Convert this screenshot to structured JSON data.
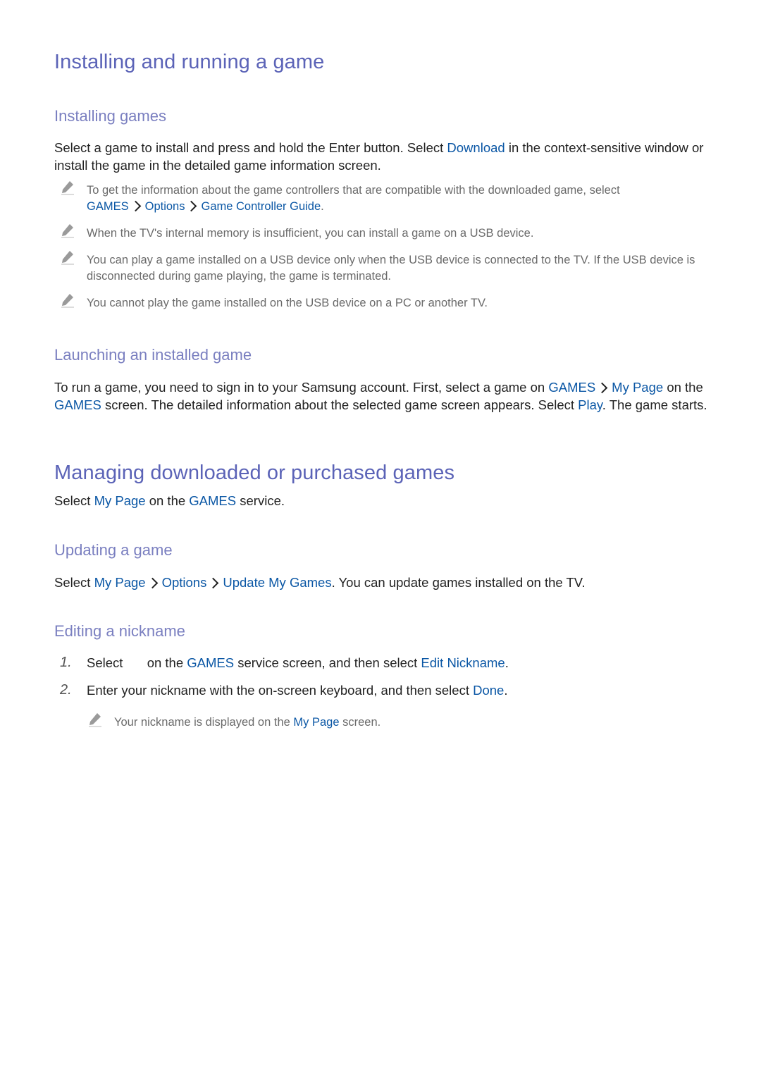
{
  "section1": {
    "title": "Installing and running a game",
    "installing": {
      "heading": "Installing games",
      "body": {
        "t1": "Select a game to install and press and hold the Enter button. Select ",
        "link1": "Download",
        "t2": " in the context-sensitive window or install the game in the detailed game information screen."
      },
      "notes": [
        {
          "text": "To get the information about the game controllers that are compatible with the downloaded game, select ",
          "path": [
            "GAMES",
            "Options",
            "Game Controller Guide"
          ],
          "end": "."
        },
        {
          "text": "When the TV's internal memory is insufficient, you can install a game on a USB device."
        },
        {
          "text": "You can play a game installed on a USB device only when the USB device is connected to the TV. If the USB device is disconnected during game playing, the game is terminated."
        },
        {
          "text": "You cannot play the game installed on the USB device on a PC or another TV."
        }
      ]
    },
    "launching": {
      "heading": "Launching an installed game",
      "body": {
        "t1": "To run a game, you need to sign in to your Samsung account. First, select a game on ",
        "link1": "GAMES",
        "link2": "My Page",
        "t2": " on the ",
        "link3": "GAMES",
        "t3": " screen. The detailed information about the selected game screen appears. Select ",
        "link4": "Play",
        "t4": ". The game starts."
      }
    }
  },
  "section2": {
    "title": "Managing downloaded or purchased games",
    "intro": {
      "t1": "Select ",
      "link1": "My Page",
      "t2": " on the ",
      "link2": "GAMES",
      "t3": " service."
    },
    "updating": {
      "heading": "Updating a game",
      "body": {
        "t1": "Select ",
        "path": [
          "My Page",
          "Options",
          "Update My Games"
        ],
        "t2": ". You can update games installed on the TV."
      }
    },
    "editing": {
      "heading": "Editing a nickname",
      "steps": [
        {
          "num": "1.",
          "t1": "Select ",
          "t2": " on the ",
          "link1": "GAMES",
          "t3": " service screen, and then select ",
          "link2": "Edit Nickname",
          "t4": "."
        },
        {
          "num": "2.",
          "t1": "Enter your nickname with the on-screen keyboard, and then select ",
          "link1": "Done",
          "t2": "."
        }
      ],
      "note": {
        "t1": "Your nickname is displayed on the ",
        "link1": "My Page",
        "t2": " screen."
      }
    }
  },
  "icons": {
    "note": "pencil-icon",
    "separator": "chevron-right-icon"
  },
  "colors": {
    "title": "#5b63b7",
    "subheading": "#7a7fc0",
    "link": "#0b57a5",
    "body": "#222222",
    "note": "#6a6a6a"
  }
}
